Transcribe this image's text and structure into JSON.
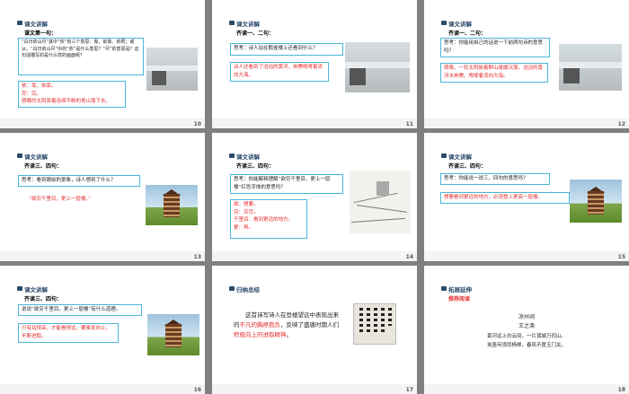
{
  "slides": [
    {
      "num": "10",
      "title": "课文讲解",
      "sub": "课文第一句：",
      "q": "“白日依山尽”其中“依”有三个意思：靠、依靠、依照；或从。“白日依山尽”中的“依”是什么意思？“尽”的意思是？这句话描写的是什么样的画面呢？",
      "a": [
        "依：靠、依靠。",
        "尽：完。",
        "傍晚的太阳靠着连绵不断的青山落下去。"
      ]
    },
    {
      "num": "11",
      "title": "课文讲解",
      "sub": "齐读一、二句：",
      "q": "思考：诗人站在鹳雀楼上还看到什么？",
      "a": [
        "诗人还看到了滔滔的黄河，奔腾咆哮着流向大海。"
      ]
    },
    {
      "num": "12",
      "title": "课文讲解",
      "sub": "齐读一、二句：",
      "q": "思考：你能用自己的话说一下前两句诗的意思吗？",
      "a": [
        "傍晚，一轮太阳挨着群山缓缓沉落，滔滔的黄河水奔腾、咆哮着流向大海。"
      ]
    },
    {
      "num": "13",
      "title": "课文讲解",
      "sub": "齐读三、四句：",
      "q": "思考：看到眼前的景象，诗人想到了什么？",
      "a": [
        "“欲穷千里目，更上一层楼。”"
      ]
    },
    {
      "num": "14",
      "title": "课文讲解",
      "sub": "齐读三、四句：",
      "q": "思考：你能解释理解“欲穷千里目，更上一层楼”红色字体的意思吗？",
      "a": [
        "欲：想要。",
        "穷：穷尽。",
        "千里目：看到更远的地方。",
        "更：再。"
      ]
    },
    {
      "num": "15",
      "title": "课文讲解",
      "sub": "齐读三、四句：",
      "q": "思考：你能说一说三、四句的意思吗？",
      "a": [
        "想要看到更远的地方，必须登上更高一层楼。"
      ]
    },
    {
      "num": "16",
      "title": "课文讲解",
      "sub": "齐读三、四句：",
      "q": "说说“欲穷千里目，更上一层楼”有什么道理。",
      "a": [
        "只有站得高，才能看得远，要奋发向上，不断进取。"
      ]
    },
    {
      "num": "17",
      "title": "归纳总结",
      "summary_parts": [
        "这首诗写诗人在登楼望远中表现出来的",
        "不凡的胸襟抱负",
        "，反映了盛唐时期人们",
        "积极向上的进取精神",
        "。"
      ]
    },
    {
      "num": "18",
      "title": "拓展延伸",
      "sub": "推荐阅读",
      "poem_title": "凉州词",
      "poem_author": "王之涣",
      "poem_lines": [
        "黄河远上白云间，一片孤城万仞山。",
        "羌笛何须怨杨柳，春风不度玉门关。"
      ]
    }
  ]
}
